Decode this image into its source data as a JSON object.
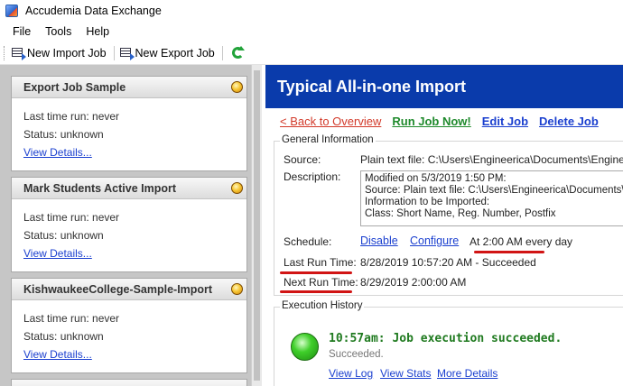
{
  "window": {
    "title": "Accudemia Data Exchange"
  },
  "menu": [
    "File",
    "Tools",
    "Help"
  ],
  "toolbar": {
    "new_import": "New Import Job",
    "new_export": "New Export Job"
  },
  "jobs": [
    {
      "title": "Export Job Sample",
      "last_run": "Last time run: never",
      "status": "Status: unknown",
      "link": "View Details..."
    },
    {
      "title": "Mark Students Active Import",
      "last_run": "Last time run: never",
      "status": "Status: unknown",
      "link": "View Details..."
    },
    {
      "title": "KishwaukeeCollege-Sample-Import",
      "last_run": "Last time run: never",
      "status": "Status: unknown",
      "link": "View Details..."
    }
  ],
  "detail": {
    "title": "Typical All-in-one Import",
    "actions": {
      "back": "< Back to Overview",
      "run": "Run Job Now!",
      "edit": "Edit Job",
      "delete": "Delete Job"
    },
    "general": {
      "label": "General Information",
      "source_label": "Source:",
      "source_value": "Plain text file: C:\\Users\\Engineerica\\Documents\\Engineerica",
      "description_label": "Description:",
      "description_lines": [
        "Modified on 5/3/2019 1:50 PM:",
        "Source: Plain text file: C:\\Users\\Engineerica\\Documents\\Engineerica",
        "Information to be Imported:",
        "Class: Short Name, Reg. Number, Postfix"
      ],
      "schedule_label": "Schedule:",
      "schedule_disable": "Disable",
      "schedule_configure": "Configure",
      "schedule_text": "At 2:00 AM every day",
      "last_run_label": "Last Run Time:",
      "last_run_value": "8/28/2019 10:57:20 AM - Succeeded",
      "next_run_label": "Next Run Time:",
      "next_run_value": "8/29/2019 2:00:00 AM"
    },
    "history": {
      "label": "Execution History",
      "message": "10:57am: Job execution succeeded.",
      "sub": "Succeeded.",
      "view_log": "View Log",
      "view_stats": "View Stats",
      "more_details": "More Details"
    }
  }
}
